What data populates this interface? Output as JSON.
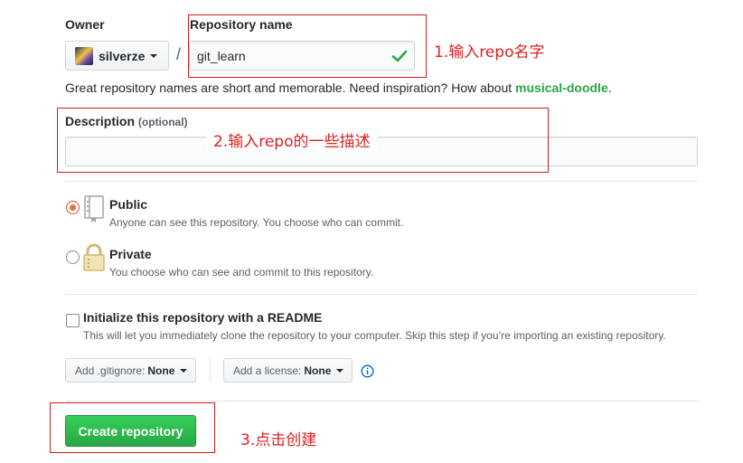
{
  "owner": {
    "label": "Owner",
    "name": "silverze"
  },
  "slash": "/",
  "repo_name": {
    "label": "Repository name",
    "value": "git_learn"
  },
  "hint": {
    "text": "Great repository names are short and memorable. Need inspiration? How about ",
    "suggestion": "musical-doodle",
    "end": "."
  },
  "description": {
    "label": "Description",
    "optional": "(optional)",
    "value": ""
  },
  "visibility": {
    "public": {
      "title": "Public",
      "desc": "Anyone can see this repository. You choose who can commit.",
      "selected": true
    },
    "private": {
      "title": "Private",
      "desc": "You choose who can see and commit to this repository.",
      "selected": false
    }
  },
  "readme": {
    "title": "Initialize this repository with a README",
    "desc": "This will let you immediately clone the repository to your computer. Skip this step if you’re importing an existing repository."
  },
  "gitignore": {
    "label": "Add .gitignore:",
    "value": "None"
  },
  "license": {
    "label": "Add a license:",
    "value": "None"
  },
  "create_button": "Create repository",
  "annotations": {
    "a1": "1.输入repo名字",
    "a2": "2.输入repo的一些描述",
    "a3": "3.点击创建"
  },
  "colors": {
    "accent_green": "#28a745",
    "annotation_red": "#e02020",
    "radio_selected": "#e4734f"
  }
}
